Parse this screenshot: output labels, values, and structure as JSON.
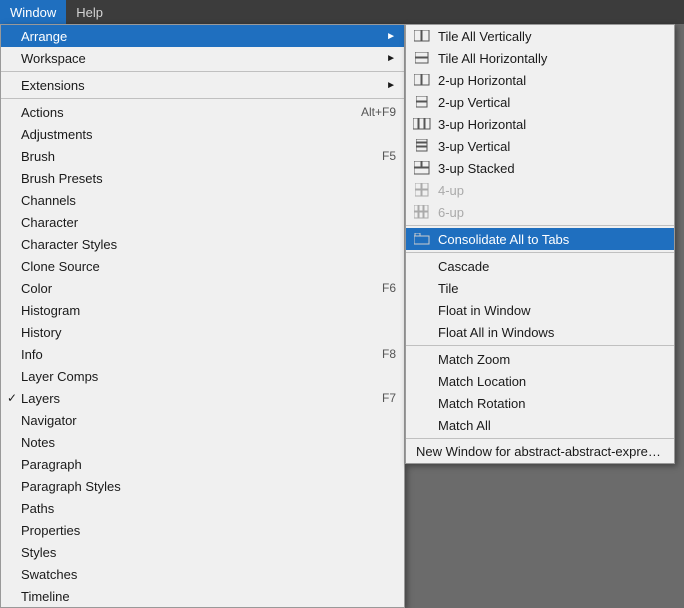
{
  "menubar": {
    "items": [
      {
        "label": "Window",
        "active": true
      },
      {
        "label": "Help",
        "active": false
      }
    ]
  },
  "main_menu": {
    "items": [
      {
        "label": "Arrange",
        "has_arrow": true,
        "active": true,
        "shortcut": ""
      },
      {
        "label": "Workspace",
        "has_arrow": true,
        "active": false,
        "shortcut": ""
      },
      {
        "separator": true
      },
      {
        "label": "Extensions",
        "has_arrow": false,
        "active": false,
        "shortcut": ""
      },
      {
        "separator": true
      },
      {
        "label": "Actions",
        "has_arrow": false,
        "active": false,
        "shortcut": "Alt+F9"
      },
      {
        "label": "Adjustments",
        "has_arrow": false,
        "active": false,
        "shortcut": ""
      },
      {
        "label": "Brush",
        "has_arrow": false,
        "active": false,
        "shortcut": "F5"
      },
      {
        "label": "Brush Presets",
        "has_arrow": false,
        "active": false,
        "shortcut": ""
      },
      {
        "label": "Channels",
        "has_arrow": false,
        "active": false,
        "shortcut": ""
      },
      {
        "label": "Character",
        "has_arrow": false,
        "active": false,
        "shortcut": ""
      },
      {
        "label": "Character Styles",
        "has_arrow": false,
        "active": false,
        "shortcut": ""
      },
      {
        "label": "Clone Source",
        "has_arrow": false,
        "active": false,
        "shortcut": ""
      },
      {
        "label": "Color",
        "has_arrow": false,
        "active": false,
        "shortcut": "F6"
      },
      {
        "label": "Histogram",
        "has_arrow": false,
        "active": false,
        "shortcut": ""
      },
      {
        "label": "History",
        "has_arrow": false,
        "active": false,
        "shortcut": ""
      },
      {
        "label": "Info",
        "has_arrow": false,
        "active": false,
        "shortcut": "F8"
      },
      {
        "label": "Layer Comps",
        "has_arrow": false,
        "active": false,
        "shortcut": ""
      },
      {
        "label": "Layers",
        "has_arrow": false,
        "active": false,
        "shortcut": "F7",
        "check": true
      },
      {
        "label": "Navigator",
        "has_arrow": false,
        "active": false,
        "shortcut": ""
      },
      {
        "label": "Notes",
        "has_arrow": false,
        "active": false,
        "shortcut": ""
      },
      {
        "label": "Paragraph",
        "has_arrow": false,
        "active": false,
        "shortcut": ""
      },
      {
        "label": "Paragraph Styles",
        "has_arrow": false,
        "active": false,
        "shortcut": ""
      },
      {
        "label": "Paths",
        "has_arrow": false,
        "active": false,
        "shortcut": ""
      },
      {
        "label": "Properties",
        "has_arrow": false,
        "active": false,
        "shortcut": ""
      },
      {
        "label": "Styles",
        "has_arrow": false,
        "active": false,
        "shortcut": ""
      },
      {
        "label": "Swatches",
        "has_arrow": false,
        "active": false,
        "shortcut": ""
      },
      {
        "label": "Timeline",
        "has_arrow": false,
        "active": false,
        "shortcut": ""
      }
    ]
  },
  "arrange_submenu": {
    "items": [
      {
        "label": "Tile All Vertically",
        "icon": "tile-v"
      },
      {
        "label": "Tile All Horizontally",
        "icon": "tile-h"
      },
      {
        "label": "2-up Horizontal",
        "icon": "2up-h"
      },
      {
        "label": "2-up Vertical",
        "icon": "2up-v"
      },
      {
        "label": "3-up Horizontal",
        "icon": "3up-h"
      },
      {
        "label": "3-up Vertical",
        "icon": "3up-v"
      },
      {
        "label": "3-up Stacked",
        "icon": "3up-s"
      },
      {
        "label": "4-up",
        "icon": "4up",
        "disabled": true
      },
      {
        "label": "6-up",
        "icon": "6up",
        "disabled": true
      },
      {
        "separator": true
      },
      {
        "label": "Consolidate All to Tabs",
        "icon": "tab",
        "active": true
      },
      {
        "separator": true
      },
      {
        "label": "Cascade",
        "icon": null
      },
      {
        "label": "Tile",
        "icon": null
      },
      {
        "label": "Float in Window",
        "icon": null
      },
      {
        "label": "Float All in Windows",
        "icon": null
      },
      {
        "separator": true
      },
      {
        "label": "Match Zoom",
        "icon": null
      },
      {
        "label": "Match Location",
        "icon": null
      },
      {
        "label": "Match Rotation",
        "icon": null
      },
      {
        "label": "Match All",
        "icon": null
      },
      {
        "separator": true
      },
      {
        "label": "New Window for abstract-abstract-expressionis",
        "icon": null,
        "new_window": true
      }
    ]
  }
}
